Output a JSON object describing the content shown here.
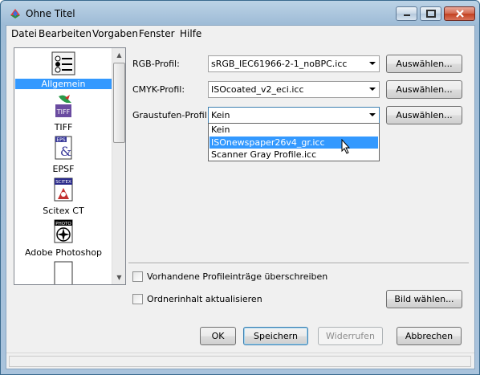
{
  "window": {
    "title": "Ohne Titel"
  },
  "menu": [
    "Datei",
    "Bearbeiten",
    "Vorgaben",
    "Fenster",
    "Hilfe"
  ],
  "sidebar": {
    "items": [
      {
        "label": "Allgemein",
        "icon": "settings-icon",
        "selected": true
      },
      {
        "label": "TIFF",
        "icon": "tiff-icon",
        "selected": false
      },
      {
        "label": "EPSF",
        "icon": "epsf-icon",
        "selected": false
      },
      {
        "label": "Scitex CT",
        "icon": "scitex-icon",
        "selected": false
      },
      {
        "label": "Adobe Photoshop",
        "icon": "photoshop-icon",
        "selected": false
      }
    ]
  },
  "profiles": {
    "rgb": {
      "label": "RGB-Profil:",
      "value": "sRGB_IEC61966-2-1_noBPC.icc",
      "button": "Auswählen..."
    },
    "cmyk": {
      "label": "CMYK-Profil:",
      "value": "ISOcoated_v2_eci.icc",
      "button": "Auswählen..."
    },
    "gray": {
      "label": "Graustufen-Profil:",
      "value": "Kein",
      "button": "Auswählen..."
    }
  },
  "dropdown": {
    "options": [
      "Kein",
      "ISOnewspaper26v4_gr.icc",
      "Scanner Gray Profile.icc"
    ],
    "hovered_index": 1
  },
  "options": {
    "overwrite": {
      "label": "Vorhandene Profileinträge überschreiben",
      "checked": false
    },
    "refresh": {
      "label": "Ordnerinhalt aktualisieren",
      "checked": false
    }
  },
  "buttons": {
    "choose_image": "Bild wählen...",
    "ok": "OK",
    "save": "Speichern",
    "revert": "Widerrufen",
    "cancel": "Abbrechen"
  },
  "colors": {
    "selection": "#3399ff",
    "titlebar": "#a9c3dc"
  }
}
